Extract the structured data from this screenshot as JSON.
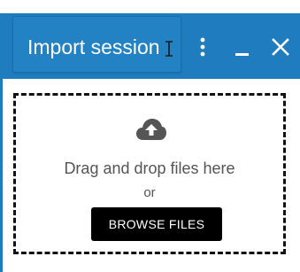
{
  "header": {
    "title": "Import session",
    "accent_color": "#1f7dbf",
    "menu_icon": "more-vertical-icon",
    "minimize_icon": "minimize-icon",
    "close_icon": "close-icon"
  },
  "dropzone": {
    "icon": "cloud-upload-icon",
    "drop_text": "Drag and drop files here",
    "or_text": "or",
    "browse_label": "BROWSE FILES"
  }
}
